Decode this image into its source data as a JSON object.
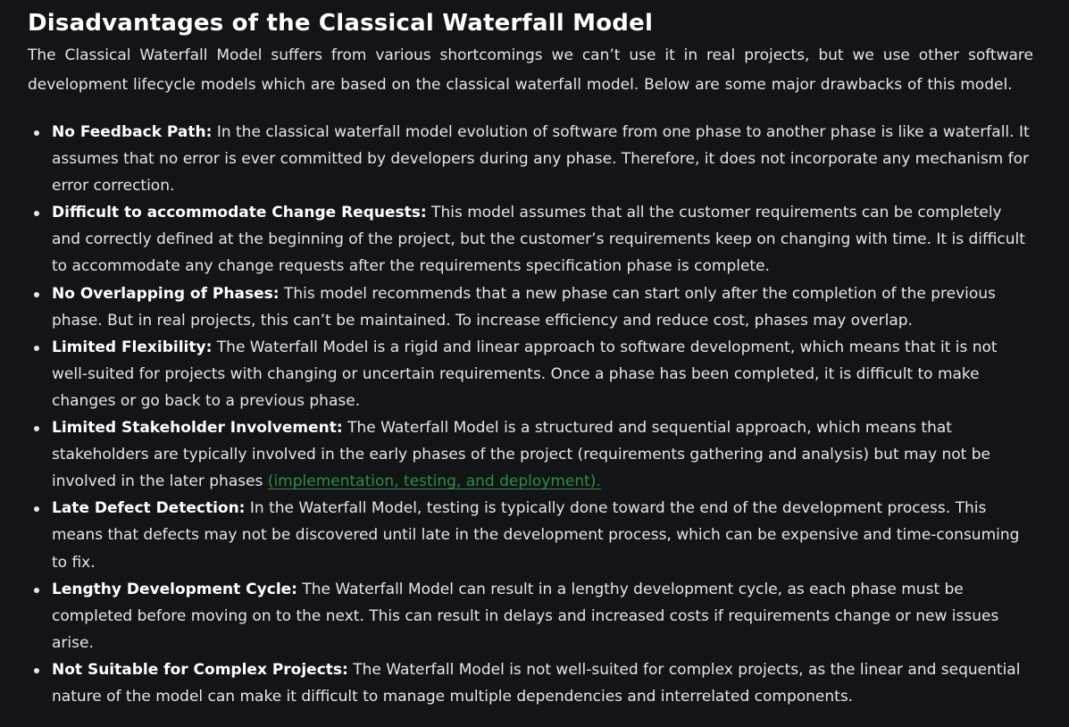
{
  "article": {
    "title": "Disadvantages of the Classical Waterfall Model",
    "intro": "The Classical Waterfall Model suffers from various shortcomings we can’t use it in real projects, but we use other software development lifecycle models which are based on the classical waterfall model. Below are some major drawbacks of this model.",
    "items": [
      {
        "term": "No Feedback Path:",
        "text": " In the classical waterfall model evolution of software from one phase to another phase is like a waterfall. It assumes that no error is ever committed by developers during any phase. Therefore, it does not incorporate any mechanism for error correction."
      },
      {
        "term": "Difficult to accommodate Change Requests:",
        "text": " This model assumes that all the customer requirements can be completely and correctly defined at the beginning of the project, but the customer’s requirements keep on changing with time. It is difficult to accommodate any change requests after the requirements specification phase is complete."
      },
      {
        "term": "No Overlapping of Phases:",
        "text": " This model recommends that a new phase can start only after the completion of the previous phase. But in real projects, this can’t be maintained. To increase efficiency and reduce cost, phases may overlap."
      },
      {
        "term": "Limited Flexibility:",
        "text": " The Waterfall Model is a rigid and linear approach to software development, which means that it is not well-suited for projects with changing or uncertain requirements. Once a phase has been completed, it is difficult to make changes or go back to a previous phase."
      },
      {
        "term": "Limited Stakeholder Involvement:",
        "text": " The Waterfall Model is a structured and sequential approach, which means that stakeholders are typically involved in the early phases of the project (requirements gathering and analysis) but may not be involved in the later phases ",
        "link": "(implementation, testing, and deployment)."
      },
      {
        "term": "Late Defect Detection:",
        "text": " In the Waterfall Model, testing is typically done toward the end of the development process. This means that defects may not be discovered until late in the development process, which can be expensive and time-consuming to fix."
      },
      {
        "term": "Lengthy Development Cycle:",
        "text": " The Waterfall Model can result in a lengthy development cycle, as each phase must be completed before moving on to the next. This can result in delays and increased costs if requirements change or new issues arise."
      },
      {
        "term": "Not Suitable for Complex Projects:",
        "text": " The Waterfall Model is not well-suited for complex projects, as the linear and sequential nature of the model can make it difficult to manage multiple dependencies and interrelated components."
      }
    ]
  },
  "colors": {
    "background": "#131417",
    "text": "#e6e6e6",
    "heading": "#ffffff",
    "link": "#2f8d46"
  }
}
